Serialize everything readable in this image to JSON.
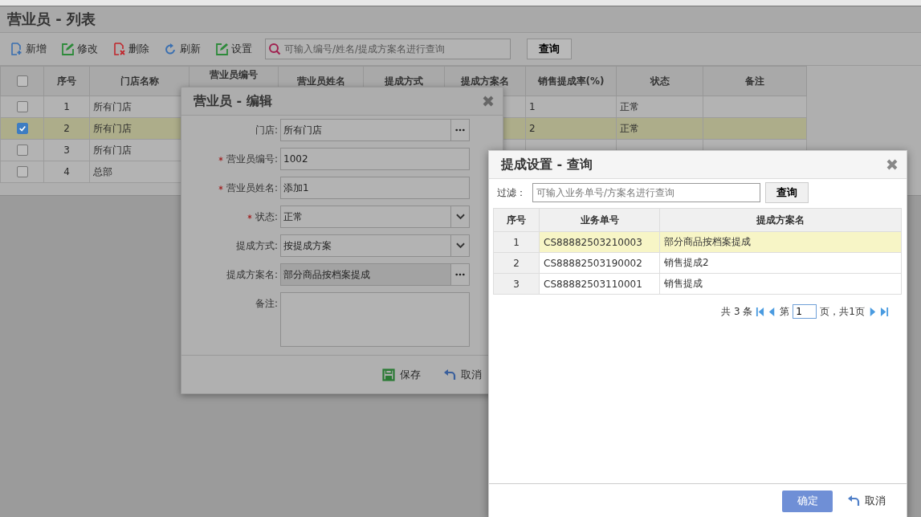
{
  "page": {
    "title": "营业员 - 列表"
  },
  "toolbar": {
    "buttons": [
      {
        "kind": "add",
        "label": "新增"
      },
      {
        "kind": "edit",
        "label": "修改"
      },
      {
        "kind": "delete",
        "label": "删除"
      },
      {
        "kind": "refresh",
        "label": "刷新"
      },
      {
        "kind": "settings",
        "label": "设置"
      }
    ],
    "search": {
      "placeholder": "可输入编号/姓名/提成方案名进行查询"
    },
    "search_button": "查询"
  },
  "table": {
    "select_all": {
      "checked": false
    },
    "columns": [
      "序号",
      "门店名称",
      "营业员编号",
      "营业员姓名",
      "提成方式",
      "提成方案名",
      "销售提成率(%)",
      "状态",
      "备注"
    ],
    "rows": [
      {
        "checked": false,
        "selected": false,
        "no": "1",
        "store": "所有门店",
        "rate": "1",
        "status": "正常"
      },
      {
        "checked": true,
        "selected": true,
        "no": "2",
        "store": "所有门店",
        "rate": "2",
        "status": "正常"
      },
      {
        "checked": false,
        "selected": false,
        "no": "3",
        "store": "所有门店"
      },
      {
        "checked": false,
        "selected": false,
        "no": "4",
        "store": "总部"
      }
    ]
  },
  "edit_dialog": {
    "title": "营业员 - 编辑",
    "fields": [
      {
        "kind": "picker",
        "required": false,
        "disabled": false,
        "label": "门店:",
        "value": "所有门店"
      },
      {
        "kind": "text",
        "required": true,
        "disabled": false,
        "label": "营业员编号:",
        "value": "1002"
      },
      {
        "kind": "text",
        "required": true,
        "disabled": false,
        "label": "营业员姓名:",
        "value": "添加1"
      },
      {
        "kind": "select",
        "required": true,
        "disabled": false,
        "label": "状态:",
        "value": "正常"
      },
      {
        "kind": "select",
        "required": false,
        "disabled": false,
        "label": "提成方式:",
        "value": "按提成方案"
      },
      {
        "kind": "picker",
        "required": false,
        "disabled": true,
        "label": "提成方案名:",
        "value": "部分商品按档案提成"
      },
      {
        "kind": "textarea",
        "required": false,
        "disabled": false,
        "label": "备注:"
      }
    ],
    "save": "保存",
    "cancel": "取消"
  },
  "query_dialog": {
    "title": "提成设置 - 查询",
    "filter_label": "过滤：",
    "filter": {
      "placeholder": "可输入业务单号/方案名进行查询"
    },
    "query_button": "查询",
    "columns": [
      "序号",
      "业务单号",
      "提成方案名"
    ],
    "rows": [
      {
        "selected": true,
        "no": "1",
        "code": "CS88882503210003",
        "plan": "部分商品按档案提成"
      },
      {
        "selected": false,
        "no": "2",
        "code": "CS88882503190002",
        "plan": "销售提成2"
      },
      {
        "selected": false,
        "no": "3",
        "code": "CS88882503110001",
        "plan": "销售提成"
      }
    ],
    "pager": {
      "total": "共 3 条",
      "page_prefix": "第",
      "page": "1",
      "page_suffix": "页，共1页"
    },
    "ok": "确定",
    "cancel": "取消"
  }
}
